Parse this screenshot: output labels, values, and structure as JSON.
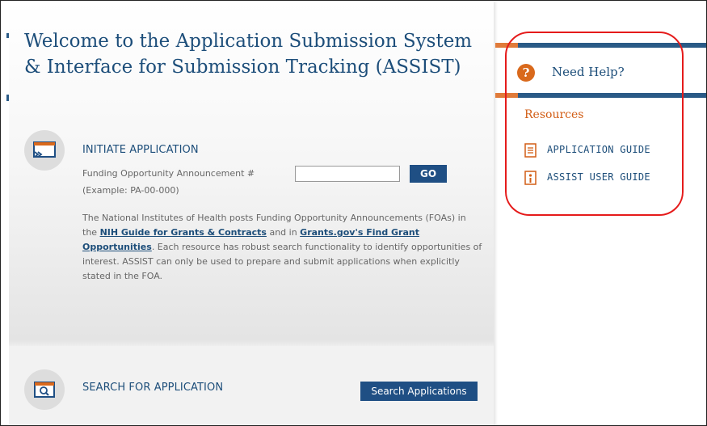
{
  "header": {
    "welcome_line1": "Welcome to the Application Submission System",
    "welcome_line2": "& Interface for Submission Tracking (ASSIST)"
  },
  "initiate": {
    "title": "INITIATE APPLICATION",
    "foa_label": "Funding Opportunity Announcement #",
    "foa_input_value": "",
    "example": "(Example: PA-00-000)",
    "go_label": "GO",
    "desc_part1": "The National Institutes of Health posts Funding Opportunity Announcements (FOAs) in the ",
    "link_nih": "NIH Guide for Grants & Contracts",
    "desc_part2": " and in ",
    "link_grants": "Grants.gov's Find Grant Opportunities",
    "desc_part3": ". Each resource has robust search functionality to identify opportunities of interest. ASSIST can only be used to prepare and submit applications when explicitly stated in the FOA."
  },
  "search": {
    "title": "SEARCH FOR APPLICATION",
    "button_label": "Search Applications"
  },
  "help": {
    "icon_glyph": "?",
    "title": "Need Help?",
    "resources_label": "Resources",
    "links": [
      {
        "label": "APPLICATION GUIDE",
        "icon": "document-icon"
      },
      {
        "label": "ASSIST USER GUIDE",
        "icon": "user-guide-icon"
      }
    ]
  },
  "colors": {
    "brand_blue": "#1d4e7a",
    "button_blue": "#1f4f84",
    "accent_orange": "#d9691c",
    "highlight_red": "#e51b1b"
  }
}
